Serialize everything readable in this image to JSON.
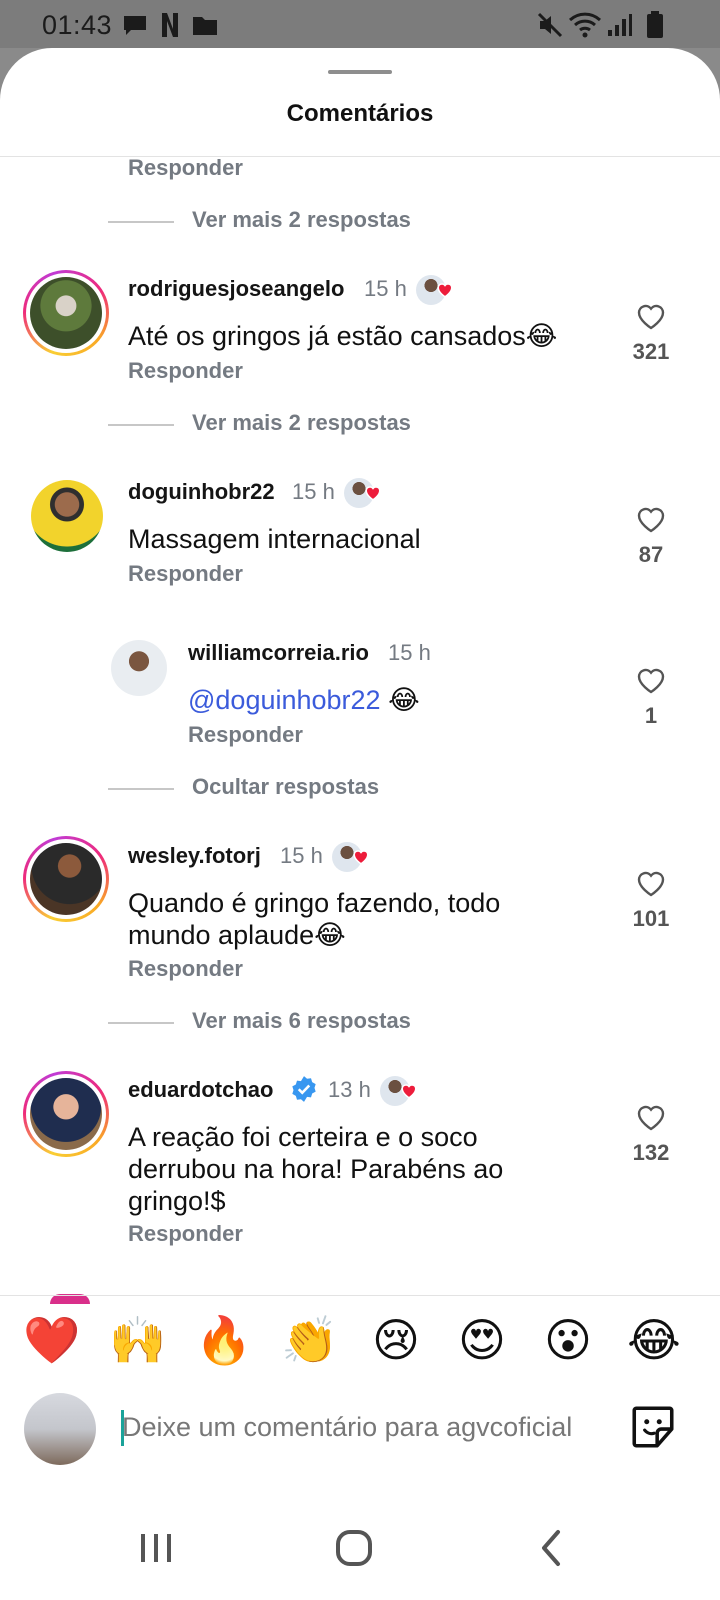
{
  "status_bar": {
    "time": "01:43"
  },
  "sheet": {
    "title": "Comentários"
  },
  "top": {
    "reply_label": "Responder",
    "more_label": "Ver mais 2 respostas"
  },
  "comments": [
    {
      "username": "rodriguesjoseangelo",
      "time": "15 h",
      "text": "Até os gringos já estão cansados😂",
      "likes": "321",
      "reply_label": "Responder",
      "more_label": "Ver mais 2 respostas"
    },
    {
      "username": "doguinhobr22",
      "time": "15 h",
      "text": "Massagem internacional",
      "likes": "87",
      "reply_label": "Responder"
    },
    {
      "username": "williamcorreia.rio",
      "time": "15 h",
      "mention": "@doguinhobr22",
      "text_after": " 😂",
      "likes": "1",
      "reply_label": "Responder",
      "hide_label": "Ocultar respostas"
    },
    {
      "username": "wesley.fotorj",
      "time": "15 h",
      "text_line1": "Quando é gringo fazendo, todo",
      "text_line2": "mundo aplaude😂",
      "likes": "101",
      "reply_label": "Responder",
      "more_label": "Ver mais 6 respostas"
    },
    {
      "username": "eduardotchao",
      "time": "13 h",
      "text_line1": "A reação foi certeira e o soco",
      "text_line2": "derrubou na hora! Parabéns ao",
      "text_line3": "gringo!$",
      "likes": "132",
      "reply_label": "Responder"
    }
  ],
  "emoji_bar": [
    "❤️",
    "🙌",
    "🔥",
    "👏",
    "😢",
    "😍",
    "😮",
    "😂"
  ],
  "composer": {
    "placeholder": "Deixe um comentário para agvcoficial"
  },
  "colors": {
    "accent_blue": "#3b5bdb",
    "like_heart": "#ed4956",
    "verified": "#3897f0"
  }
}
